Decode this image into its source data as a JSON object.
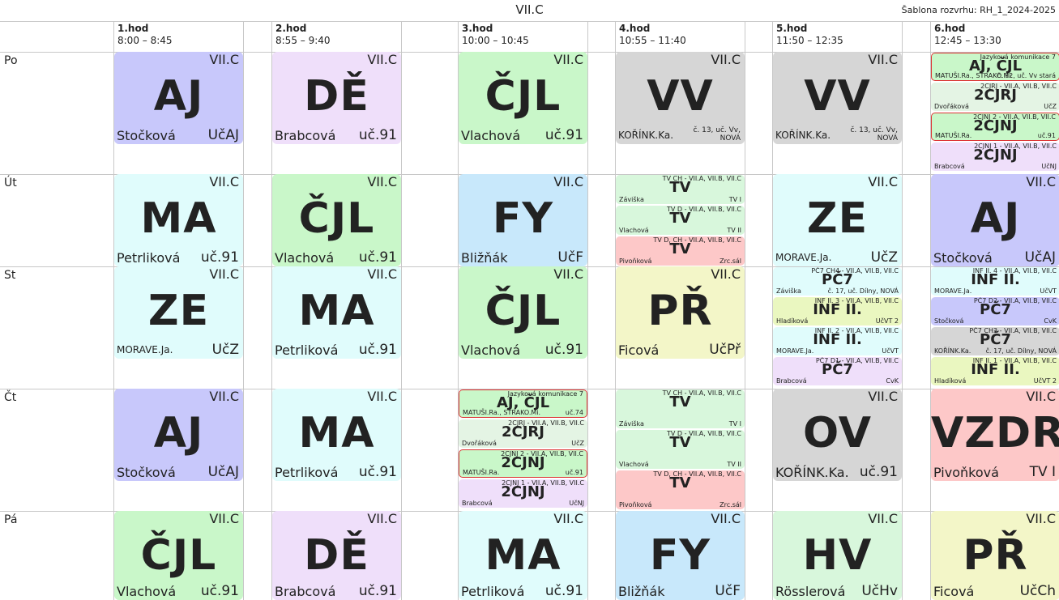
{
  "title": "VII.C",
  "template_label": "Šablona rozvrhu: RH_1_2024-2025",
  "periods": [
    {
      "num": "1.hod",
      "time": "8:00 – 8:45"
    },
    {
      "num": "2.hod",
      "time": "8:55 – 9:40"
    },
    {
      "num": "3.hod",
      "time": "10:00 – 10:45"
    },
    {
      "num": "4.hod",
      "time": "10:55 – 11:40"
    },
    {
      "num": "5.hod",
      "time": "11:50 – 12:35"
    },
    {
      "num": "6.hod",
      "time": "12:45 – 13:30"
    }
  ],
  "days": [
    "Po",
    "Út",
    "St",
    "Čt",
    "Pá"
  ],
  "colors": {
    "AJ": "#c8c8fb",
    "DE": "#efdffa",
    "CJL": "#c9f7c9",
    "VV": "#d6d6d6",
    "MA": "#e0fcfc",
    "FY": "#c8e8fb",
    "TV1": "#d8f7dc",
    "TV2": "#dcf7dc",
    "TVR": "#fdc8c8",
    "ZE": "#e0fcfc",
    "PR": "#f3f6c8",
    "OV": "#d6d6d6",
    "VZDR": "#fdc8c8",
    "HV": "#d8f7dc",
    "INF": "#eaf7c0",
    "PC": "#c8c8fb",
    "CJRJ": "#e4f4e4",
    "CJNJ": "#efdffa"
  },
  "schedule": [
    [
      {
        "type": "big",
        "subject": "AJ",
        "cls": "VII.C",
        "teacher": "Stočková",
        "room": "UčAJ",
        "color": "#c8c8fb"
      },
      {
        "type": "big",
        "subject": "DĚ",
        "cls": "VII.C",
        "teacher": "Brabcová",
        "room": "uč.91",
        "color": "#efdffa"
      },
      {
        "type": "big",
        "subject": "ČJL",
        "cls": "VII.C",
        "teacher": "Vlachová",
        "room": "uč.91",
        "color": "#c9f7c9"
      },
      {
        "type": "big",
        "subject": "VV",
        "cls": "VII.C",
        "teacher": "KOŘÍNK.Ka.",
        "room": "č. 13, uč. Vv, NOVÁ",
        "color": "#d6d6d6",
        "small_text": true
      },
      {
        "type": "big",
        "subject": "VV",
        "cls": "VII.C",
        "teacher": "KOŘÍNK.Ka.",
        "room": "č. 13, uč. Vv, NOVÁ",
        "color": "#d6d6d6",
        "small_text": true
      },
      {
        "type": "split",
        "parts": [
          {
            "group": "Jazyková komunikace 7",
            "subject": "AJ, ČJL",
            "teacher": "MATUŠI.Ra., STRAKO.Mi.",
            "room": "č. 92, uč. Vv stará",
            "color": "#c9f7c9",
            "red": true
          },
          {
            "group": "2CJRJ - VII.A, VII.B, VII.C",
            "subject": "2CJRJ",
            "teacher": "Dvořáková",
            "room": "UčZ",
            "color": "#e4f4e4"
          },
          {
            "group": "2CJNJ 2 - VII.A, VII.B, VII.C",
            "subject": "2CJNJ",
            "teacher": "MATUŠI.Ra.",
            "room": "uč.91",
            "color": "#c9f7c9",
            "red": true
          },
          {
            "group": "2CJNJ 1 - VII.A, VII.B, VII.C",
            "subject": "2CJNJ",
            "teacher": "Brabcová",
            "room": "UčNJ",
            "color": "#efdffa"
          }
        ]
      }
    ],
    [
      {
        "type": "big",
        "subject": "MA",
        "cls": "VII.C",
        "teacher": "Petrliková",
        "room": "uč.91",
        "color": "#e0fcfc"
      },
      {
        "type": "big",
        "subject": "ČJL",
        "cls": "VII.C",
        "teacher": "Vlachová",
        "room": "uč.91",
        "color": "#c9f7c9"
      },
      {
        "type": "big",
        "subject": "FY",
        "cls": "VII.C",
        "teacher": "Bližňák",
        "room": "UčF",
        "color": "#c8e8fb"
      },
      {
        "type": "split",
        "parts": [
          {
            "group": "TV CH - VII.A, VII.B, VII.C",
            "subject": "TV",
            "teacher": "Záviška",
            "room": "TV I",
            "color": "#d8f7dc"
          },
          {
            "group": "TV D - VII.A, VII.B, VII.C",
            "subject": "TV",
            "teacher": "Vlachová",
            "room": "TV II",
            "color": "#d8f7dc"
          },
          {
            "group": "TV D, CH - VII.A, VII.B, VII.C",
            "subject": "TV",
            "teacher": "Pivoňková",
            "room": "Zrc.sál",
            "color": "#fdc8c8"
          }
        ]
      },
      {
        "type": "big",
        "subject": "ZE",
        "cls": "VII.C",
        "teacher": "MORAVE.Ja.",
        "room": "UčZ",
        "color": "#e0fcfc",
        "small_teacher": true
      },
      {
        "type": "big",
        "subject": "AJ",
        "cls": "VII.C",
        "teacher": "Stočková",
        "room": "UčAJ",
        "color": "#c8c8fb"
      }
    ],
    [
      {
        "type": "big",
        "subject": "ZE",
        "cls": "VII.C",
        "teacher": "MORAVE.Ja.",
        "room": "UčZ",
        "color": "#e0fcfc",
        "small_teacher": true
      },
      {
        "type": "big",
        "subject": "MA",
        "cls": "VII.C",
        "teacher": "Petrliková",
        "room": "uč.91",
        "color": "#e0fcfc"
      },
      {
        "type": "big",
        "subject": "ČJL",
        "cls": "VII.C",
        "teacher": "Vlachová",
        "room": "uč.91",
        "color": "#c9f7c9"
      },
      {
        "type": "big",
        "subject": "PŘ",
        "cls": "VII.C",
        "teacher": "Ficová",
        "room": "UčPř",
        "color": "#f3f6c8"
      },
      {
        "type": "split",
        "parts": [
          {
            "group": "PČ7 CH4 - VII.A, VII.B, VII.C",
            "subject": "PČ7",
            "teacher": "Záviška",
            "room": "č. 17, uč. Dílny, NOVÁ",
            "color": "#e0fcfc"
          },
          {
            "group": "INF II. 3 - VII.A, VII.B, VII.C",
            "subject": "INF II.",
            "teacher": "Hladíková",
            "room": "UčVT 2",
            "color": "#eaf7c0"
          },
          {
            "group": "INF II. 2 - VII.A, VII.B, VII.C",
            "subject": "INF II.",
            "teacher": "MORAVE.Ja.",
            "room": "UčVT",
            "color": "#e0fcfc"
          },
          {
            "group": "PČ7 D1 - VII.A, VII.B, VII.C",
            "subject": "PČ7",
            "teacher": "Brabcová",
            "room": "CvK",
            "color": "#efdffa"
          }
        ]
      },
      {
        "type": "split",
        "parts": [
          {
            "group": "INF II. 4 - VII.A, VII.B, VII.C",
            "subject": "INF II.",
            "teacher": "MORAVE.Ja.",
            "room": "UčVT",
            "color": "#e0fcfc"
          },
          {
            "group": "PČ7 D2 - VII.A, VII.B, VII.C",
            "subject": "PČ7",
            "teacher": "Stočková",
            "room": "CvK",
            "color": "#c8c8fb"
          },
          {
            "group": "PČ7 CH3 - VII.A, VII.B, VII.C",
            "subject": "PČ7",
            "teacher": "KOŘÍNK.Ka.",
            "room": "č. 17, uč. Dílny, NOVÁ",
            "color": "#d6d6d6"
          },
          {
            "group": "INF II. 1 - VII.A, VII.B, VII.C",
            "subject": "INF II.",
            "teacher": "Hladíková",
            "room": "UčVT 2",
            "color": "#eaf7c0"
          }
        ]
      }
    ],
    [
      {
        "type": "big",
        "subject": "AJ",
        "cls": "VII.C",
        "teacher": "Stočková",
        "room": "UčAJ",
        "color": "#c8c8fb"
      },
      {
        "type": "big",
        "subject": "MA",
        "cls": "VII.C",
        "teacher": "Petrliková",
        "room": "uč.91",
        "color": "#e0fcfc"
      },
      {
        "type": "split",
        "parts": [
          {
            "group": "Jazyková komunikace 7",
            "subject": "AJ, ČJL",
            "teacher": "MATUŠI.Ra., STRAKO.Mi.",
            "room": "uč.74",
            "color": "#c9f7c9",
            "red": true
          },
          {
            "group": "2CJRJ - VII.A, VII.B, VII.C",
            "subject": "2CJRJ",
            "teacher": "Dvořáková",
            "room": "UčZ",
            "color": "#e4f4e4"
          },
          {
            "group": "2CJNJ 2 - VII.A, VII.B, VII.C",
            "subject": "2CJNJ",
            "teacher": "MATUŠI.Ra.",
            "room": "uč.91",
            "color": "#c9f7c9",
            "red": true
          },
          {
            "group": "2CJNJ 1 - VII.A, VII.B, VII.C",
            "subject": "2CJNJ",
            "teacher": "Brabcová",
            "room": "UčNJ",
            "color": "#efdffa"
          }
        ]
      },
      {
        "type": "split",
        "parts": [
          {
            "group": "TV CH - VII.A, VII.B, VII.C",
            "subject": "TV",
            "teacher": "Záviška",
            "room": "TV I",
            "color": "#d8f7dc"
          },
          {
            "group": "TV D - VII.A, VII.B, VII.C",
            "subject": "TV",
            "teacher": "Vlachová",
            "room": "TV II",
            "color": "#d8f7dc"
          },
          {
            "group": "TV D, CH - VII.A, VII.B, VII.C",
            "subject": "TV",
            "teacher": "Pivoňková",
            "room": "Zrc.sál",
            "color": "#fdc8c8"
          }
        ]
      },
      {
        "type": "big",
        "subject": "OV",
        "cls": "VII.C",
        "teacher": "KOŘÍNK.Ka.",
        "room": "uč.91",
        "color": "#d6d6d6"
      },
      {
        "type": "big",
        "subject": "VZDR",
        "cls": "VII.C",
        "teacher": "Pivoňková",
        "room": "TV I",
        "color": "#fdc8c8"
      }
    ],
    [
      {
        "type": "big",
        "subject": "ČJL",
        "cls": "VII.C",
        "teacher": "Vlachová",
        "room": "uč.91",
        "color": "#c9f7c9"
      },
      {
        "type": "big",
        "subject": "DĚ",
        "cls": "VII.C",
        "teacher": "Brabcová",
        "room": "uč.91",
        "color": "#efdffa"
      },
      {
        "type": "big",
        "subject": "MA",
        "cls": "VII.C",
        "teacher": "Petrliková",
        "room": "uč.91",
        "color": "#e0fcfc"
      },
      {
        "type": "big",
        "subject": "FY",
        "cls": "VII.C",
        "teacher": "Bližňák",
        "room": "UčF",
        "color": "#c8e8fb"
      },
      {
        "type": "big",
        "subject": "HV",
        "cls": "VII.C",
        "teacher": "Rösslerová",
        "room": "UčHv",
        "color": "#d8f7dc"
      },
      {
        "type": "big",
        "subject": "PŘ",
        "cls": "VII.C",
        "teacher": "Ficová",
        "room": "UčCh",
        "color": "#f3f6c8"
      }
    ]
  ]
}
